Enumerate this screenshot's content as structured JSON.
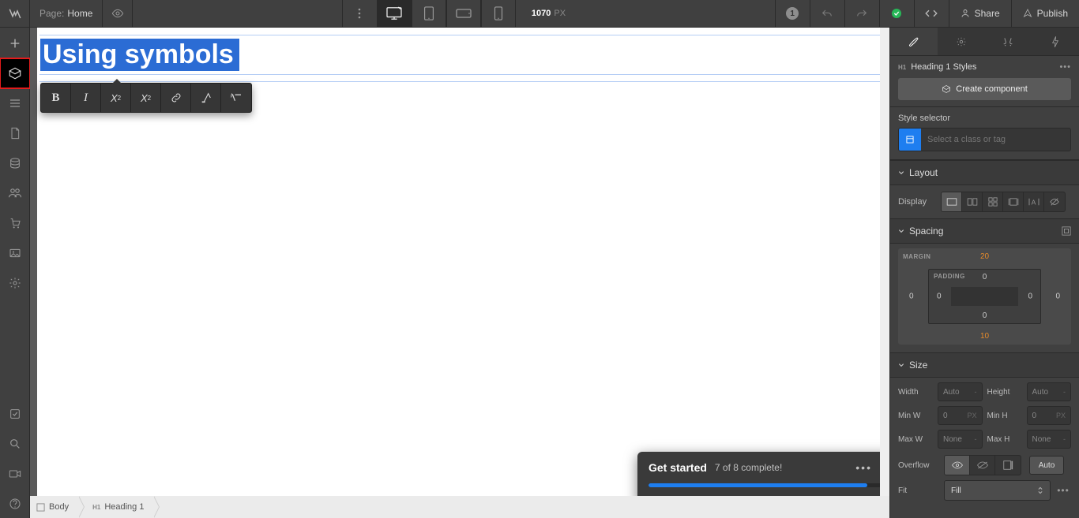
{
  "topbar": {
    "page_label": "Page:",
    "page_value": "Home",
    "bp_width": "1070",
    "bp_unit": "PX",
    "changes_count": "1",
    "share_label": "Share",
    "publish_label": "Publish"
  },
  "canvas": {
    "heading_text": "Using symbols"
  },
  "onboard": {
    "title": "Get started",
    "status": "7 of 8 complete!"
  },
  "breadcrumb": {
    "body_tag": "□",
    "body_label": "Body",
    "h1_tag": "H1",
    "h1_label": "Heading 1"
  },
  "right_panel": {
    "header_tag": "H1",
    "header_title": "Heading 1 Styles",
    "create_component": "Create component",
    "style_selector_label": "Style selector",
    "style_selector_placeholder": "Select a class or tag",
    "layout_title": "Layout",
    "display_label": "Display",
    "spacing_title": "Spacing",
    "margin_label": "MARGIN",
    "padding_label": "PADDING",
    "margin": {
      "top": "20",
      "right": "0",
      "bottom": "10",
      "left": "0"
    },
    "padding": {
      "top": "0",
      "right": "0",
      "bottom": "0",
      "left": "0"
    },
    "size_title": "Size",
    "width_label": "Width",
    "width_value": "Auto",
    "width_unit": "-",
    "height_label": "Height",
    "height_value": "Auto",
    "height_unit": "-",
    "minw_label": "Min W",
    "minw_value": "0",
    "minw_unit": "PX",
    "minh_label": "Min H",
    "minh_value": "0",
    "minh_unit": "PX",
    "maxw_label": "Max W",
    "maxw_value": "None",
    "maxw_unit": "-",
    "maxh_label": "Max H",
    "maxh_value": "None",
    "maxh_unit": "-",
    "overflow_label": "Overflow",
    "overflow_auto": "Auto",
    "fit_label": "Fit",
    "fit_value": "Fill"
  }
}
